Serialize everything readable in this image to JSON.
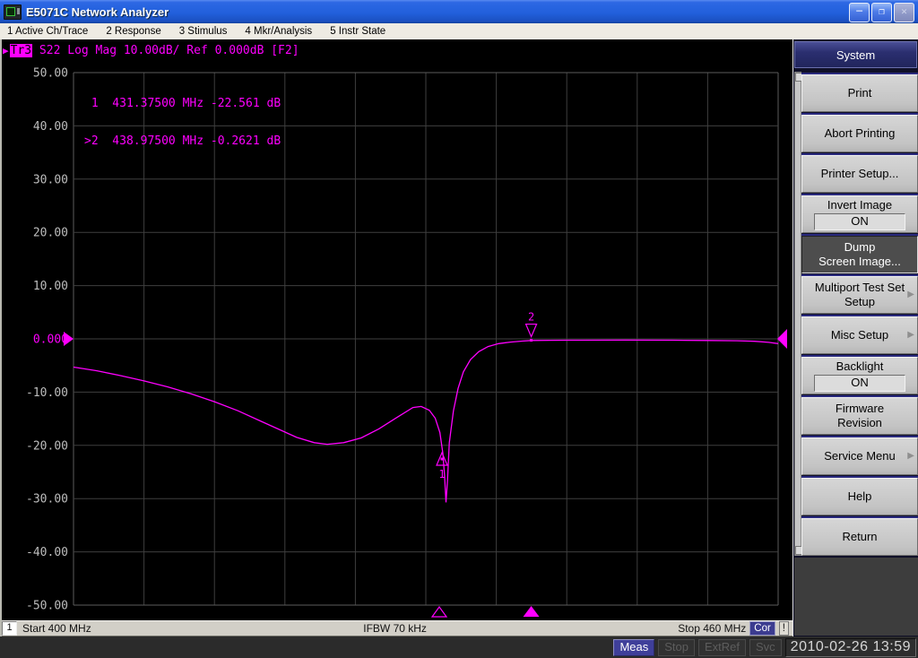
{
  "window": {
    "title": "E5071C Network Analyzer",
    "controls": {
      "minimize": "─",
      "restore": "❐",
      "close": "✕"
    }
  },
  "menu_bar": {
    "items": [
      {
        "label": "1 Active Ch/Trace"
      },
      {
        "label": "2 Response"
      },
      {
        "label": "3 Stimulus"
      },
      {
        "label": "4 Mkr/Analysis"
      },
      {
        "label": "5 Instr State"
      }
    ]
  },
  "trace_header": {
    "active_glyph": "▶",
    "trace_id": "Tr3",
    "text": " S22 Log Mag 10.00dB/ Ref 0.000dB [F2]"
  },
  "marker_readout": {
    "lines": [
      " 1  431.37500 MHz -22.561 dB",
      ">2  438.97500 MHz -0.2621 dB"
    ]
  },
  "chart_data": {
    "type": "line",
    "x_unit": "MHz",
    "y_unit": "dB",
    "xlim": [
      400,
      460
    ],
    "ylim": [
      -50,
      50
    ],
    "x_divisions": 10,
    "y_divisions": 10,
    "grid": true,
    "y_tick_labels": [
      "50.00",
      "40.00",
      "30.00",
      "20.00",
      "10.00",
      "0.000",
      "-10.00",
      "-20.00",
      "-30.00",
      "-40.00",
      "-50.00"
    ],
    "reference_level_db": 0,
    "series": [
      {
        "name": "Tr3 S22 Log Mag",
        "color": "#ff00ff",
        "points": [
          [
            400.0,
            -5.3
          ],
          [
            402.0,
            -6.0
          ],
          [
            404.0,
            -6.9
          ],
          [
            406.0,
            -7.9
          ],
          [
            408.0,
            -9.0
          ],
          [
            410.0,
            -10.3
          ],
          [
            412.0,
            -11.8
          ],
          [
            414.0,
            -13.5
          ],
          [
            416.0,
            -15.5
          ],
          [
            417.5,
            -17.0
          ],
          [
            419.0,
            -18.5
          ],
          [
            420.5,
            -19.5
          ],
          [
            421.6,
            -19.8
          ],
          [
            423.0,
            -19.5
          ],
          [
            424.5,
            -18.6
          ],
          [
            426.0,
            -16.9
          ],
          [
            427.5,
            -14.8
          ],
          [
            428.9,
            -12.9
          ],
          [
            429.6,
            -12.7
          ],
          [
            430.3,
            -13.4
          ],
          [
            430.8,
            -14.9
          ],
          [
            431.2,
            -17.6
          ],
          [
            431.45,
            -21.5
          ],
          [
            431.6,
            -26.0
          ],
          [
            431.72,
            -30.7
          ],
          [
            431.85,
            -26.5
          ],
          [
            432.0,
            -19.5
          ],
          [
            432.35,
            -13.5
          ],
          [
            432.75,
            -9.3
          ],
          [
            433.2,
            -6.2
          ],
          [
            433.8,
            -3.9
          ],
          [
            434.5,
            -2.4
          ],
          [
            435.3,
            -1.45
          ],
          [
            436.2,
            -0.9
          ],
          [
            437.2,
            -0.6
          ],
          [
            438.2,
            -0.42
          ],
          [
            439.0,
            -0.3
          ],
          [
            440.5,
            -0.27
          ],
          [
            443.0,
            -0.25
          ],
          [
            447.0,
            -0.24
          ],
          [
            451.0,
            -0.26
          ],
          [
            454.0,
            -0.3
          ],
          [
            456.5,
            -0.36
          ],
          [
            458.0,
            -0.45
          ],
          [
            459.2,
            -0.65
          ],
          [
            460.0,
            -0.9
          ]
        ]
      }
    ],
    "markers": [
      {
        "id": "1",
        "freq_mhz": 431.375,
        "value_db": -22.561,
        "active": false
      },
      {
        "id": "2",
        "freq_mhz": 438.975,
        "value_db": -0.2621,
        "active": true
      }
    ]
  },
  "channel_bar": {
    "channel": "1",
    "start": "Start 400 MHz",
    "ifbw": "IFBW 70 kHz",
    "stop": "Stop 460 MHz",
    "correction_badge": "Cor",
    "warning_badge": "!"
  },
  "status_bar": {
    "badges": [
      {
        "label": "Meas",
        "state": "active"
      },
      {
        "label": "Stop",
        "state": "disabled"
      },
      {
        "label": "ExtRef",
        "state": "disabled"
      },
      {
        "label": "Svc",
        "state": "disabled"
      }
    ],
    "datetime": "2010-02-26 13:59"
  },
  "softkey_menu": {
    "title": "System",
    "buttons": [
      {
        "label": "Print"
      },
      {
        "label": "Abort Printing"
      },
      {
        "label": "Printer Setup..."
      },
      {
        "label": "Invert Image",
        "value": "ON"
      },
      {
        "label": "Dump\nScreen Image...",
        "pressed": true
      },
      {
        "label": "Multiport Test Set\nSetup",
        "submenu": true
      },
      {
        "label": "Misc Setup",
        "submenu": true
      },
      {
        "label": "Backlight",
        "value": "ON"
      },
      {
        "label": "Firmware\nRevision"
      },
      {
        "label": "Service Menu",
        "submenu": true
      },
      {
        "label": "Help"
      },
      {
        "label": "Return"
      }
    ]
  },
  "colors": {
    "trace_magenta": "#ff00ff",
    "grid_line": "#3f3f3f",
    "grid_frame": "#5c5c5c",
    "axis_text": "#bdbdbd",
    "navy_badge": "#3c3c90",
    "titlebar_blue": "#2260dc"
  }
}
